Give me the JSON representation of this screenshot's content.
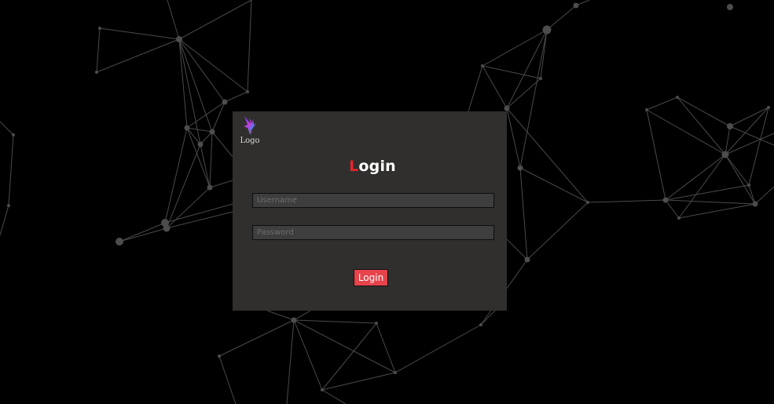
{
  "logo": {
    "text": "Logo",
    "icon": "bird-logo-icon"
  },
  "login_form": {
    "title_first_letter": "L",
    "title_rest": "ogin",
    "username_placeholder": "Username",
    "username_value": "",
    "password_placeholder": "Password",
    "password_value": "",
    "submit_label": "Login"
  },
  "colors": {
    "page_background": "#000000",
    "panel_background": "#302f2e",
    "accent_red": "#e3262b",
    "button_red": "#e6434b",
    "network_lines": "#4a4a4a"
  }
}
